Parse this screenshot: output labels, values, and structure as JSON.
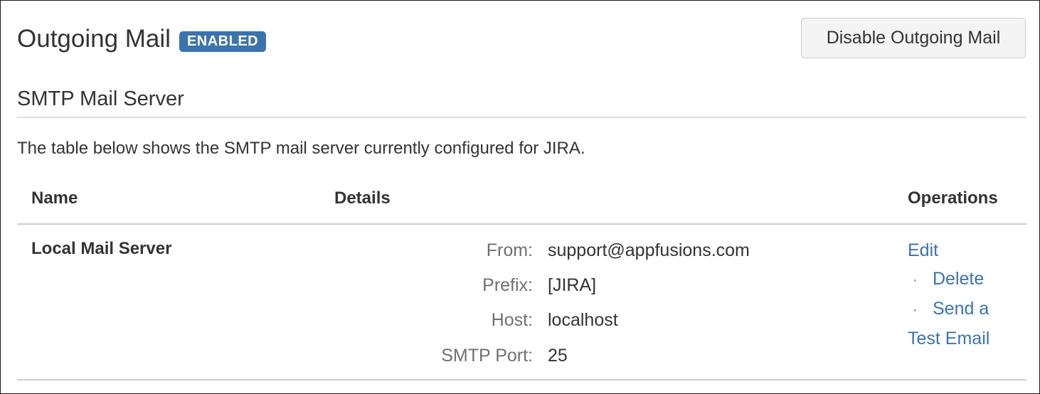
{
  "header": {
    "title": "Outgoing Mail",
    "status_badge": "ENABLED",
    "disable_button": "Disable Outgoing Mail"
  },
  "section": {
    "title": "SMTP Mail Server",
    "description": "The table below shows the SMTP mail server currently configured for JIRA."
  },
  "table": {
    "columns": [
      "Name",
      "Details",
      "Operations"
    ],
    "rows": [
      {
        "name": "Local Mail Server",
        "details": [
          {
            "label": "From:",
            "value": "support@appfusions.com"
          },
          {
            "label": "Prefix:",
            "value": "[JIRA]"
          },
          {
            "label": "Host:",
            "value": "localhost"
          },
          {
            "label": "SMTP Port:",
            "value": "25"
          }
        ],
        "operations": {
          "edit": "Edit",
          "separator": "·",
          "delete": "Delete",
          "send_test_line1": "Send a",
          "send_test_line2": "Test Email"
        }
      }
    ]
  },
  "colors": {
    "badge_bg": "#3b73af",
    "link": "#3b73af",
    "label_gray": "#707070"
  }
}
